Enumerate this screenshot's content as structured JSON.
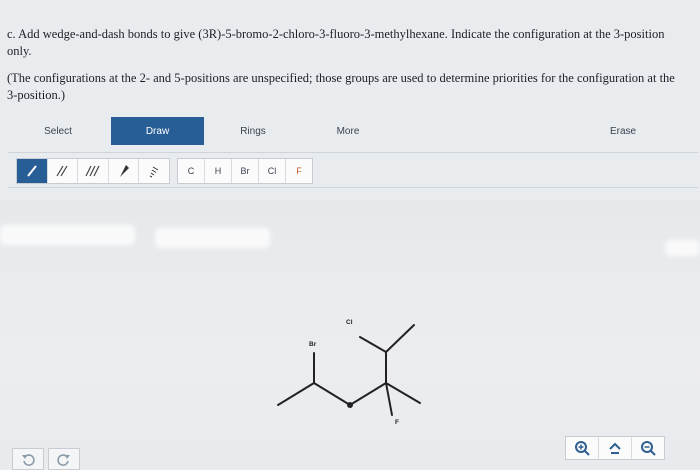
{
  "question": {
    "text": "c. Add wedge-and-dash bonds to give (3R)-5-bromo-2-chloro-3-fluoro-3-methylhexane. Indicate the configuration at the 3-position only.",
    "note": "(The configurations at the 2- and 5-positions are unspecified; those groups are used to determine priorities for the configuration at the 3-position.)"
  },
  "toolbar": {
    "select": "Select",
    "draw": "Draw",
    "rings": "Rings",
    "more": "More",
    "erase": "Erase"
  },
  "atoms": [
    "C",
    "H",
    "Br",
    "Cl",
    "F"
  ],
  "molecule": {
    "labels": {
      "cl": "Cl",
      "br": "Br",
      "f": "F"
    }
  },
  "colors": {
    "accent": "#275e96",
    "icon": "#2e5f8f"
  }
}
